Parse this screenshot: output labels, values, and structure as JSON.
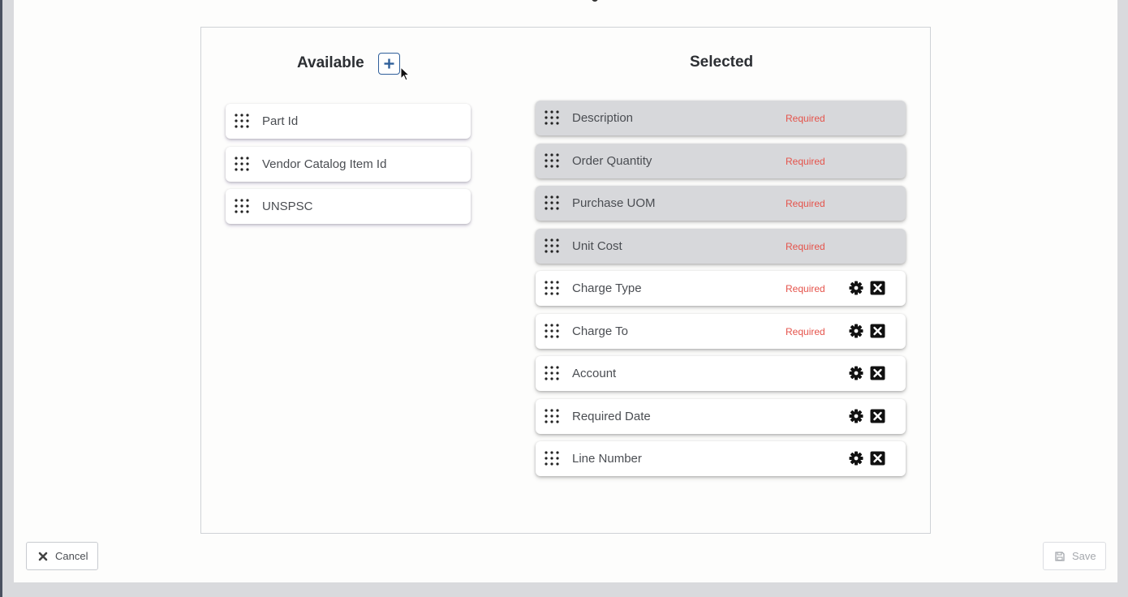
{
  "available": {
    "title": "Available",
    "items": [
      {
        "label": "Part Id"
      },
      {
        "label": "Vendor Catalog Item Id"
      },
      {
        "label": "UNSPSC"
      }
    ]
  },
  "selected": {
    "title": "Selected",
    "items": [
      {
        "label": "Description",
        "badge": "Required",
        "locked": true
      },
      {
        "label": "Order Quantity",
        "badge": "Required",
        "locked": true
      },
      {
        "label": "Purchase UOM",
        "badge": "Required",
        "locked": true
      },
      {
        "label": "Unit Cost",
        "badge": "Required",
        "locked": true
      },
      {
        "label": "Charge Type",
        "badge": "Required",
        "locked": false
      },
      {
        "label": "Charge To",
        "badge": "Required",
        "locked": false
      },
      {
        "label": "Account",
        "badge": "",
        "locked": false
      },
      {
        "label": "Required Date",
        "badge": "",
        "locked": false
      },
      {
        "label": "Line Number",
        "badge": "",
        "locked": false
      }
    ]
  },
  "footer": {
    "cancel_label": "Cancel",
    "save_label": "Save"
  },
  "colors": {
    "required": "#e5534b",
    "accent": "#2f5f9a",
    "locked_bg": "#d7d8db"
  }
}
